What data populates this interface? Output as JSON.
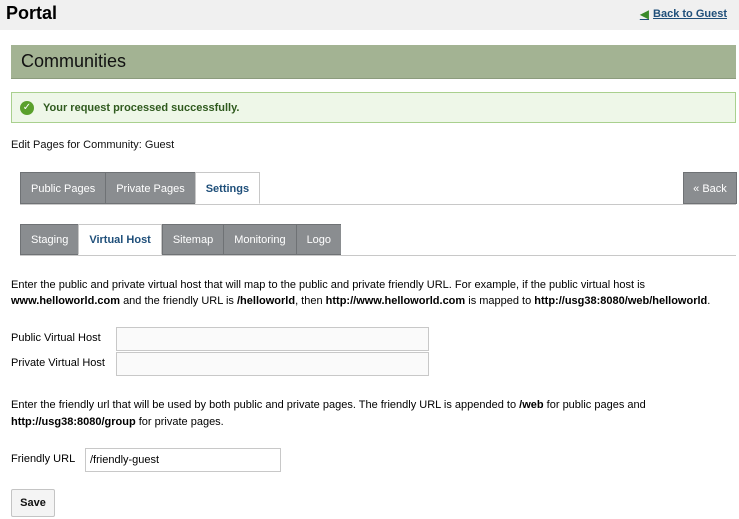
{
  "header": {
    "title": "Portal",
    "back_link": "Back to Guest"
  },
  "communities": {
    "title": "Communities"
  },
  "notice": {
    "success": "Your request processed successfully."
  },
  "edit_pages": "Edit Pages for Community: Guest",
  "tabs_primary": [
    {
      "label": "Public Pages"
    },
    {
      "label": "Private Pages"
    },
    {
      "label": "Settings",
      "active": true
    }
  ],
  "back_button": "« Back",
  "tabs_secondary": [
    {
      "label": "Staging"
    },
    {
      "label": "Virtual Host",
      "active": true
    },
    {
      "label": "Sitemap"
    },
    {
      "label": "Monitoring"
    },
    {
      "label": "Logo"
    }
  ],
  "intro": {
    "t1": "Enter the public and private virtual host that will map to the public and private friendly URL. For example, if the public virtual host is",
    "host_example": "www.helloworld.com",
    "t2": "and the friendly URL is",
    "friendly_example": "/helloworld",
    "t3": ", then",
    "full_example": "http://www.helloworld.com",
    "t4": "is mapped to",
    "mapped_example": "http://usg38:8080/web/helloworld",
    "t5": "."
  },
  "fields": {
    "public_label": "Public Virtual Host",
    "public_value": "",
    "private_label": "Private Virtual Host",
    "private_value": "",
    "friendly_label": "Friendly URL",
    "friendly_value": "/friendly-guest"
  },
  "friendly_note": {
    "t1": "Enter the friendly url that will be used by both public and private pages. The friendly URL is appended to",
    "web": "/web",
    "t2": "for public pages and",
    "group": "http://usg38:8080/group",
    "t3": "for private pages."
  },
  "save_label": "Save",
  "colors": {
    "header_bar": "#a3b393",
    "success_bg": "#eef7e8",
    "tab_inactive": "#8a8d90",
    "link": "#1f4f7a"
  }
}
